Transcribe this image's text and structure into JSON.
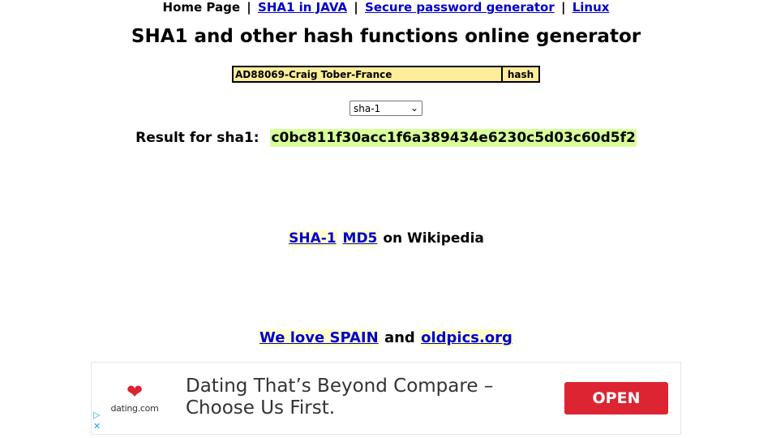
{
  "nav": {
    "home": "Home Page",
    "sep": "|",
    "links": [
      "SHA1 in JAVA",
      "Secure password generator",
      "Linux"
    ]
  },
  "title": "SHA1 and other hash functions online generator",
  "form": {
    "input_value": "AD88069-Craig Tober-France",
    "button_label": "hash",
    "algorithm": "sha-1"
  },
  "result": {
    "label": "Result for sha1:",
    "value": "c0bc811f30acc1f6a389434e6230c5d03c60d5f2"
  },
  "wiki": {
    "links": [
      "SHA-1",
      "MD5"
    ],
    "suffix": "on Wikipedia"
  },
  "promo": {
    "link1": "We love SPAIN",
    "and": "and",
    "link2": "oldpics.org"
  },
  "ad": {
    "brand": "dating.com",
    "headline": "Dating That’s Beyond Compare – Choose Us First.",
    "cta": "OPEN"
  },
  "colors": {
    "link": "#0000cc",
    "input_bg": "#ffee99",
    "result_bg": "#d8ff99",
    "ad_button": "#dd2433"
  }
}
